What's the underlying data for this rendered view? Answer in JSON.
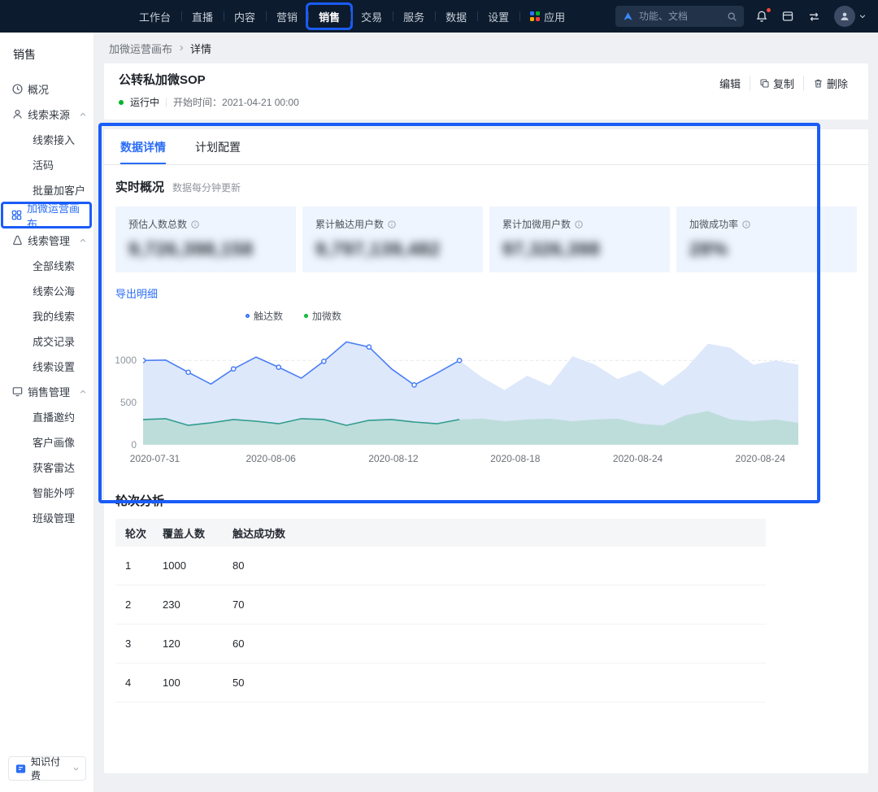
{
  "accent_colors": {
    "annotation": "#1a5cf7",
    "primary": "#2b6df5",
    "status_running": "#00b42a"
  },
  "topbar": {
    "nav": [
      {
        "label": "工作台"
      },
      {
        "label": "直播"
      },
      {
        "label": "内容"
      },
      {
        "label": "营销"
      },
      {
        "label": "销售",
        "active": true
      },
      {
        "label": "交易"
      },
      {
        "label": "服务"
      },
      {
        "label": "数据"
      },
      {
        "label": "设置"
      },
      {
        "label": "应用"
      }
    ],
    "search": {
      "placeholder": "功能、文档"
    }
  },
  "sidebar": {
    "title": "销售",
    "items": [
      {
        "label": "概况",
        "type": "item"
      },
      {
        "label": "线索来源",
        "type": "group"
      },
      {
        "label": "线索接入",
        "type": "sub"
      },
      {
        "label": "活码",
        "type": "sub"
      },
      {
        "label": "批量加客户",
        "type": "sub"
      },
      {
        "label": "加微运营画布",
        "type": "sub",
        "active": true
      },
      {
        "label": "线索管理",
        "type": "group"
      },
      {
        "label": "全部线索",
        "type": "sub"
      },
      {
        "label": "线索公海",
        "type": "sub"
      },
      {
        "label": "我的线索",
        "type": "sub"
      },
      {
        "label": "成交记录",
        "type": "sub"
      },
      {
        "label": "线索设置",
        "type": "sub"
      },
      {
        "label": "销售管理",
        "type": "group"
      },
      {
        "label": "直播邀约",
        "type": "sub"
      },
      {
        "label": "客户画像",
        "type": "sub"
      },
      {
        "label": "获客雷达",
        "type": "sub"
      },
      {
        "label": "智能外呼",
        "type": "sub"
      },
      {
        "label": "班级管理",
        "type": "sub"
      }
    ],
    "bottom_label": "知识付费"
  },
  "breadcrumb": {
    "parent": "加微运营画布",
    "current": "详情"
  },
  "header": {
    "title": "公转私加微SOP",
    "status": "运行中",
    "start_time": "开始时间：2021-04-21 00:00",
    "actions": {
      "edit": "编辑",
      "copy": "复制",
      "delete": "删除"
    }
  },
  "tabs": {
    "data_detail": "数据详情",
    "plan_config": "计划配置"
  },
  "realtime": {
    "title": "实时概况",
    "subtitle": "数据每分钟更新",
    "export_label": "导出明细",
    "stats": [
      {
        "label": "预估人数总数",
        "value": "9,726,398,158",
        "blurred": true
      },
      {
        "label": "累计触达用户数",
        "value": "9,797,139,482",
        "blurred": true
      },
      {
        "label": "累计加微用户数",
        "value": "97,326,398",
        "blurred": true
      },
      {
        "label": "加微成功率",
        "value": "28%",
        "blurred": true
      }
    ]
  },
  "chart_data": {
    "type": "area-line",
    "ylim": [
      0,
      1350
    ],
    "yticks": [
      1000,
      500,
      0
    ],
    "xtick_labels": [
      "2020-07-31",
      "2020-08-06",
      "2020-08-12",
      "2020-08-18",
      "2020-08-24",
      "2020-08-24"
    ],
    "xtick_fractions": [
      0.018,
      0.195,
      0.382,
      0.568,
      0.755,
      0.942
    ],
    "grid": "dashed-horizontal",
    "legend_position": "top-left",
    "series": [
      {
        "name": "触达数",
        "line_color": "#4b7ef5",
        "area_color": "#d9e5fa",
        "legend_color": "#3370ff",
        "line_end_index": 14,
        "values": [
          1000,
          1005,
          860,
          720,
          900,
          1040,
          920,
          790,
          990,
          1220,
          1160,
          900,
          710,
          850,
          1000,
          800,
          650,
          820,
          700,
          1050,
          950,
          780,
          880,
          700,
          900,
          1200,
          1150,
          950,
          1000,
          950
        ]
      },
      {
        "name": "加微数",
        "line_color": "#2f9c8d",
        "area_color": "#b9dcd6",
        "legend_color": "#00b42a",
        "line_end_index": 14,
        "values": [
          300,
          310,
          230,
          260,
          300,
          280,
          250,
          310,
          300,
          230,
          290,
          300,
          270,
          250,
          300,
          310,
          280,
          300,
          310,
          280,
          300,
          310,
          250,
          230,
          350,
          400,
          300,
          280,
          300,
          260
        ]
      }
    ]
  },
  "rounds": {
    "title": "轮次分析",
    "headers": [
      "轮次",
      "覆盖人数",
      "触达成功数"
    ],
    "rows": [
      [
        "1",
        "1000",
        "80"
      ],
      [
        "2",
        "230",
        "70"
      ],
      [
        "3",
        "120",
        "60"
      ],
      [
        "4",
        "100",
        "50"
      ]
    ]
  }
}
